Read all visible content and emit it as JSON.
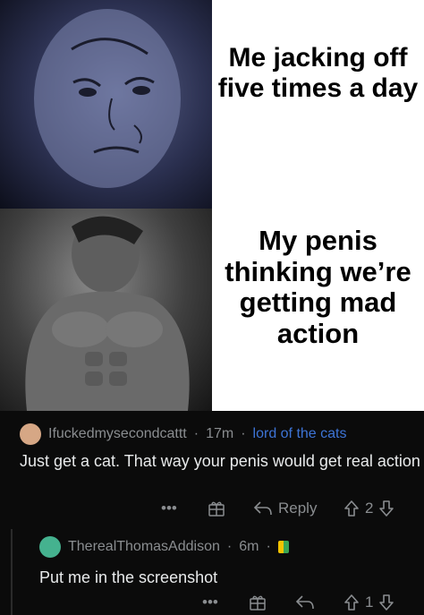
{
  "meme": {
    "top_text": "Me jacking off five times a day",
    "bottom_text": "My penis thinking we’re getting mad action"
  },
  "comment1": {
    "username": "Ifuckedmysecondcattt",
    "time": "17m",
    "flair": "lord of the cats",
    "body": "Just get a cat. That way your penis would get real action",
    "more": "•••",
    "reply_label": "Reply",
    "score": "2"
  },
  "comment2": {
    "username": "TherealThomasAddison",
    "time": "6m",
    "body": "Put me in the screenshot",
    "more": "•••",
    "score": "1"
  },
  "separators": {
    "dot": "·"
  },
  "icons": [
    "award-icon",
    "reply-arrow-icon",
    "upvote-icon",
    "downvote-icon",
    "new-user-badge-icon"
  ]
}
